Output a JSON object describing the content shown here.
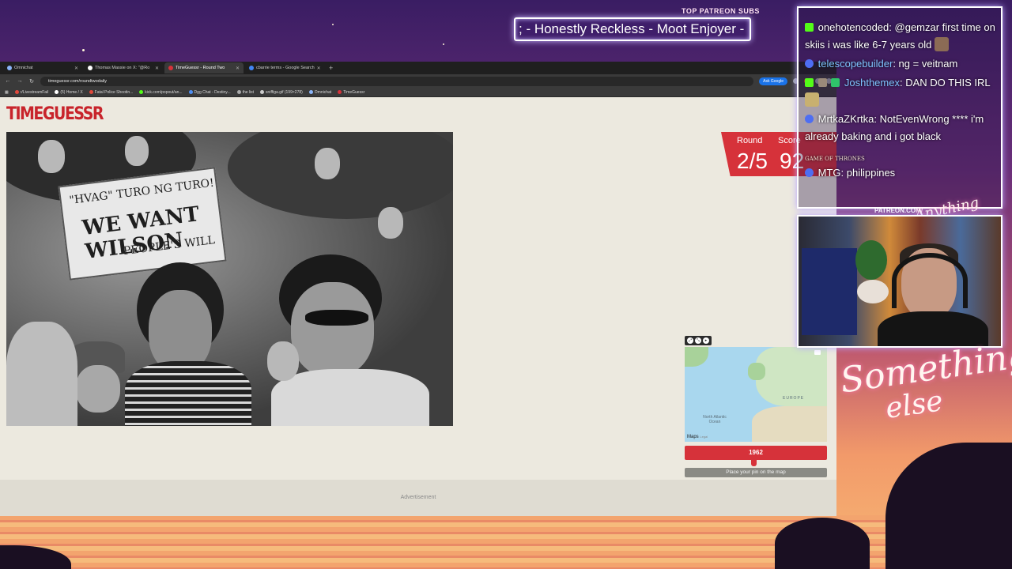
{
  "overlay": {
    "patreon_label": "TOP PATREON SUBS",
    "patreon_ticker": "; - Honestly Reckless - Moot Enjoyer -",
    "patreon_url": "PATREON.COM/",
    "script_logo_top": "Anything Else",
    "script_logo_bottom_1": "Something",
    "script_logo_bottom_2": "else"
  },
  "browser": {
    "tabs": [
      {
        "label": "Omnichat",
        "active": false
      },
      {
        "label": "Thomas Massie on X: \"@Ro",
        "active": false
      },
      {
        "label": "TimeGuessr - Round Two",
        "active": true
      },
      {
        "label": "cbarrie terms - Google Search",
        "active": false
      }
    ],
    "new_tab": "+",
    "url": "timeguessr.com/roundtwodaily",
    "ask_google": "Ask Google",
    "bookmarks": [
      "r/LivestreamFail",
      "(5) Home / X",
      "Fatal Police Shootin...",
      "kick.com/popout/an...",
      "Dgg Chat - Destiny...",
      "the list",
      "sniffiga.gif (199×278)",
      "Omnichat",
      "TimeGuessr"
    ]
  },
  "game": {
    "logo": "TIMEGUESSR",
    "round_label": "Round",
    "score_label": "Score",
    "round_value": "2/5",
    "score_value": "92",
    "photo_sign": {
      "line1": "\"HVAG\" TURO NG TURO!",
      "line2": "WE WANT WILSON",
      "line3": "PEOPLE'S WILL"
    },
    "map_labels": {
      "europe": "EUROPE",
      "ocean": "North Atlantic Ocean"
    },
    "map_attribution": "Maps",
    "map_legal": "Legal",
    "year": "1962",
    "place_pin": "Place your pin on the map",
    "advertisement": "Advertisement"
  },
  "chat": {
    "messages": [
      {
        "user": "onehotencoded",
        "text": "@gemzar first time on skiis i was like 6-7 years old",
        "platform": "kick"
      },
      {
        "user": "telescopebuilder",
        "text": "ng = veitnam",
        "platform": "twitch"
      },
      {
        "user": "Joshthemex",
        "text": "DAN DO THIS IRL",
        "platform": "kick"
      },
      {
        "user": "MrtkaZKrtka",
        "text": "NotEvenWrong ****",
        "platform": "twitch"
      },
      {
        "user": "",
        "text": "i'm already baking and i got black",
        "platform": ""
      },
      {
        "user": "MTG",
        "text": "philippines",
        "platform": "twitch"
      }
    ],
    "emote_label": "GAME OF THRONES"
  }
}
